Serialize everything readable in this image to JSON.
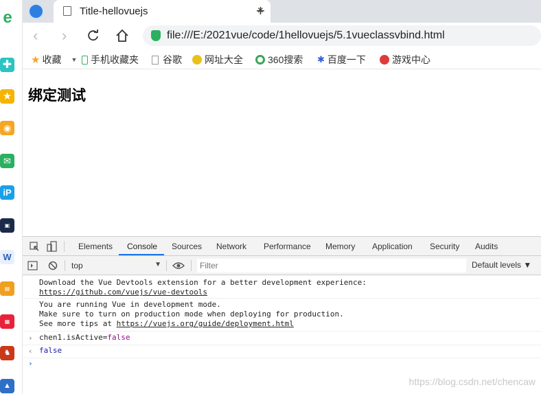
{
  "browser": {
    "tab_title": "Title-hellovuejs",
    "close_glyph": "×",
    "new_tab_glyph": "+",
    "url": "file:///E:/2021vue/code/1hellovuejs/5.1vueclassvbind.html"
  },
  "bookmarks": [
    {
      "label": "收藏",
      "color": "#f5a623"
    },
    {
      "label": "手机收藏夹",
      "color": "#2bb05f"
    },
    {
      "label": "谷歌",
      "color": "#999999"
    },
    {
      "label": "网址大全",
      "color": "#e8c21b"
    },
    {
      "label": "360搜索",
      "color": "#3aa757"
    },
    {
      "label": "百度一下",
      "color": "#2f5fd6"
    },
    {
      "label": "游戏中心",
      "color": "#e03a3a"
    }
  ],
  "page": {
    "heading": "绑定测试"
  },
  "devtools": {
    "tabs": [
      "Elements",
      "Console",
      "Sources",
      "Network",
      "Performance",
      "Memory",
      "Application",
      "Security",
      "Audits"
    ],
    "active_tab": "Console",
    "context": "top",
    "filter_placeholder": "Filter",
    "levels": "Default levels ▼",
    "messages": {
      "m1_line1": "Download the Vue Devtools extension for a better development experience:",
      "m1_link": "https://github.com/vuejs/vue-devtools",
      "m2_line1": "You are running Vue in development mode.",
      "m2_line2": "Make sure to turn on production mode when deploying for production.",
      "m2_line3_prefix": "See more tips at ",
      "m2_link": "https://vuejs.org/guide/deployment.html",
      "input_expr_left": "chen1.isActive=",
      "input_expr_right": "false",
      "output": "false"
    }
  },
  "watermark": "https://blog.csdn.net/chencaw",
  "colors": {
    "accent": "#1a73e8",
    "false_value": "#881280",
    "output_value": "#1a1aa6"
  }
}
